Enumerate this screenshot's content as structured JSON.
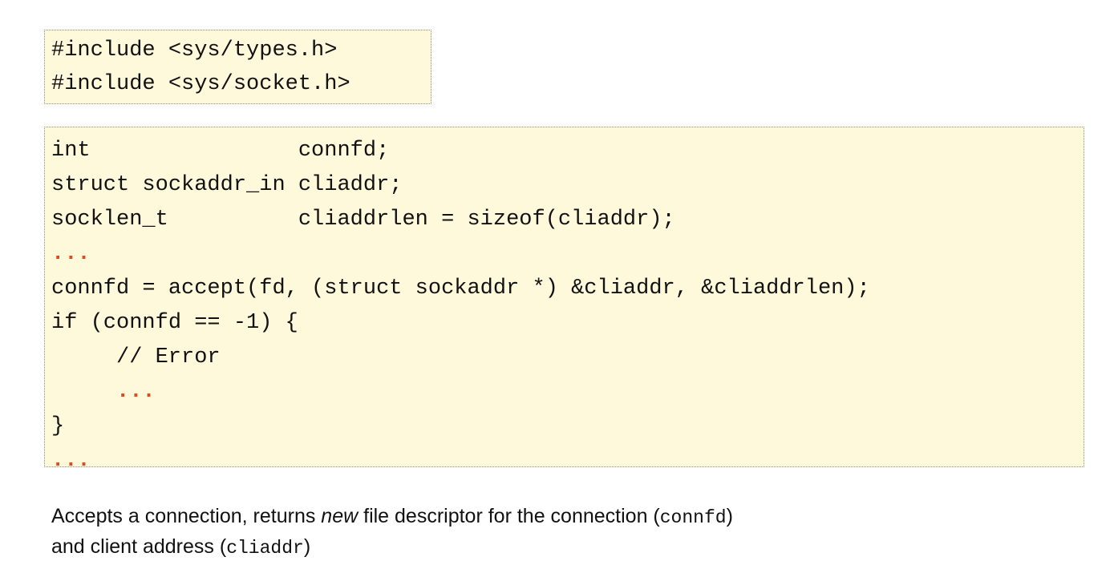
{
  "includes": [
    "#include <sys/types.h>",
    "#include <sys/socket.h>"
  ],
  "code": {
    "line1": "int                connfd;",
    "line2": "struct sockaddr_in cliaddr;",
    "line3": "socklen_t          cliaddrlen = sizeof(cliaddr);",
    "ellipsis1": "...",
    "line5": "connfd = accept(fd, (struct sockaddr *) &cliaddr, &cliaddrlen);",
    "line6": "if (connfd == -1) {",
    "line7": "// Error",
    "ellipsis2": "...",
    "line9": "}",
    "ellipsis3": "..."
  },
  "caption": {
    "part1": "Accepts a connection, returns ",
    "emphasis": "new",
    "part2": " file descriptor for the connection (",
    "code1": "connfd",
    "part3": ")",
    "part4": "and client address (",
    "code2": "cliaddr",
    "part5": ")"
  },
  "colors": {
    "code_background": "#fff9dc",
    "ellipsis": "#e8461c"
  }
}
